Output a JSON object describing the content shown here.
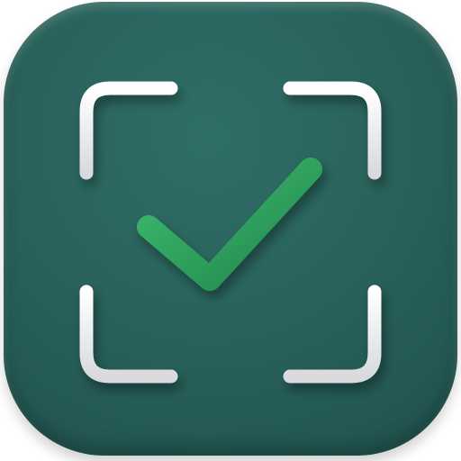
{
  "app_icon": {
    "name": "scan-check-app-icon",
    "background_color": "#2a625c",
    "bracket_color": "#f1f1f3",
    "check_color": "#2f9a5b",
    "glyphs": [
      "scan-frame-icon",
      "checkmark-icon"
    ]
  }
}
